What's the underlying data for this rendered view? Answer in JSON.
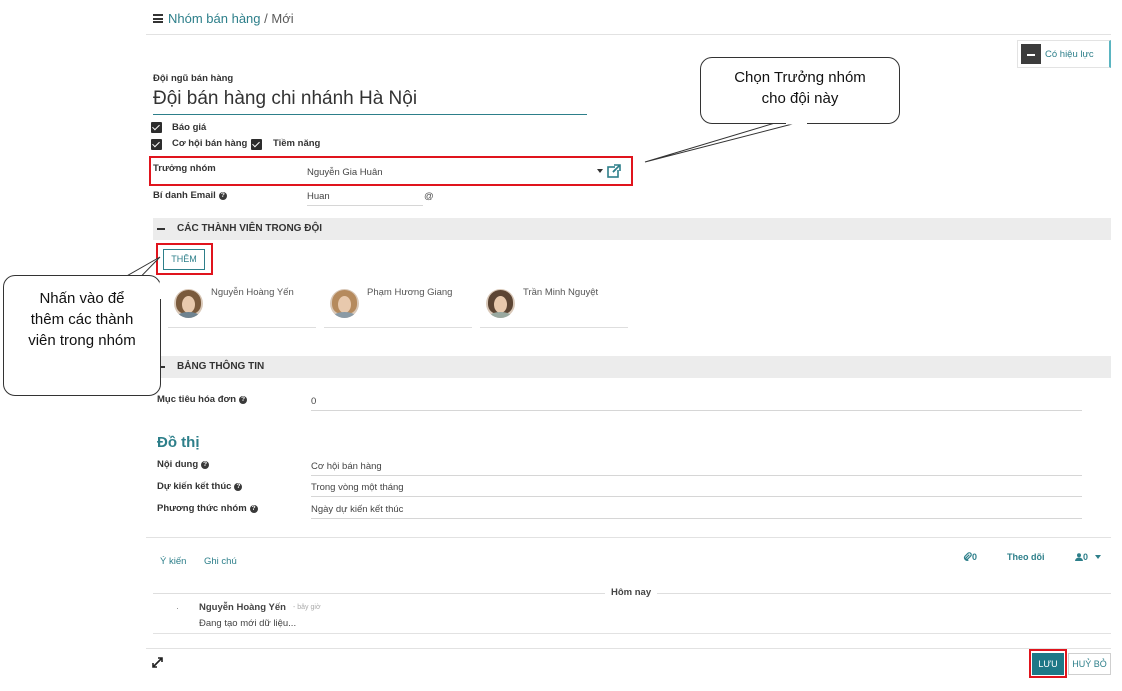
{
  "breadcrumb": {
    "parent": "Nhóm bán hàng",
    "separator": "/",
    "current": "Mới"
  },
  "status_button": {
    "label": "Có hiệu lực"
  },
  "form": {
    "team_label": "Đội ngũ bán hàng",
    "team_name": "Đội bán hàng chi nhánh Hà Nội",
    "checkboxes": {
      "quotations": "Báo giá",
      "opportunities": "Cơ hội bán hàng",
      "leads": "Tiềm năng"
    },
    "leader_label": "Trưởng nhóm",
    "leader_value": "Nguyễn Gia Huân",
    "email_alias_label": "Bí danh Email",
    "email_alias_value": "Huan",
    "email_at": "@"
  },
  "members_section": {
    "title": "CÁC THÀNH VIÊN TRONG ĐỘI",
    "add_button": "THÊM",
    "members": [
      {
        "name": "Nguyễn Hoàng Yến"
      },
      {
        "name": "Phạm Hương Giang"
      },
      {
        "name": "Trần Minh Nguyệt"
      }
    ]
  },
  "dashboard_section": {
    "title": "BẢNG THÔNG TIN",
    "invoice_target_label": "Mục tiêu hóa đơn",
    "invoice_target_value": "0",
    "graph_heading": "Đồ thị",
    "content_label": "Nội dung",
    "content_value": "Cơ hội bán hàng",
    "expected_close_label": "Dự kiến kết thúc",
    "expected_close_value": "Trong vòng một tháng",
    "group_method_label": "Phương thức nhóm",
    "group_method_value": "Ngày dự kiến kết thúc"
  },
  "chatter": {
    "tab_comment": "Ý kiến",
    "tab_note": "Ghi chú",
    "attachments_count": "0",
    "follow_label": "Theo dõi",
    "followers_count": "0",
    "date_separator": "Hôm nay",
    "message_author": "Nguyễn Hoàng Yến",
    "message_time": "- bây giờ",
    "message_body": "Đang tạo mới dữ liệu..."
  },
  "footer": {
    "save": "LƯU",
    "cancel": "HUỶ BỎ"
  },
  "callouts": {
    "leader_tip": "Chọn Trưởng nhóm cho đội này",
    "members_tip": "Nhấn vào để thêm các thành viên trong nhóm"
  },
  "colors": {
    "accent": "#2d7f8a",
    "highlight": "#e0141d",
    "primary_button": "#1e7887"
  },
  "icons": {
    "menu": "hamburger-icon",
    "archive": "archive-icon",
    "external": "external-link-icon",
    "help": "question-icon",
    "attachment": "paperclip-icon",
    "followers": "user-icon",
    "expand": "expand-icon"
  }
}
